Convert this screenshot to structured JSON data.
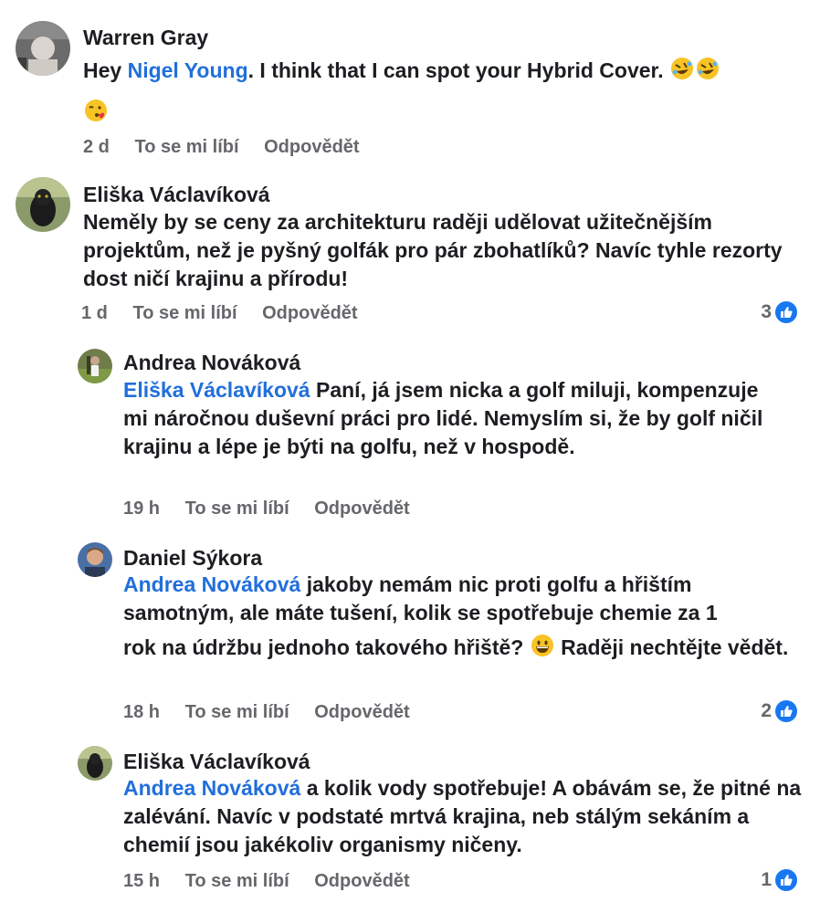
{
  "comments": [
    {
      "author": "Warren Gray",
      "mention": "Nigel Young",
      "text_before": "Hey ",
      "text_after": ". I think that I can spot your Hybrid Cover.",
      "emojis": [
        "rolling-on-floor-laughing",
        "rolling-on-floor-laughing",
        "face-blowing-kiss"
      ],
      "time": "2 d",
      "like_label": "To se mi líbí",
      "reply_label": "Odpovědět"
    },
    {
      "author": "Eliška Václavíková",
      "text": "Neměly by se ceny za architekturu raději udělovat užitečnějším projektům, než je pyšný golfák pro pár zbohatlíků? Navíc tyhle rezorty dost ničí krajinu a přírodu!",
      "time": "1 d",
      "like_label": "To se mi líbí",
      "reply_label": "Odpovědět",
      "likes": "3"
    },
    {
      "author": "Andrea Nováková",
      "mention": "Eliška Václavíková",
      "text": "Paní, já jsem nicka a golf miluji, kompenzuje mi náročnou duševní práci pro lidé. Nemyslím si, že by golf ničil krajinu a lépe je býti na golfu, než v hospodě.",
      "time": "19 h",
      "like_label": "To se mi líbí",
      "reply_label": "Odpovědět"
    },
    {
      "author": "Daniel Sýkora",
      "mention": "Andrea Nováková",
      "text_line1": "jakoby nemám nic proti golfu a hřištím samotným, ale máte tušení, kolik se spotřebuje chemie za 1",
      "text_line2_a": "rok na údržbu jednoho takového hřiště?",
      "text_line2_b": "Raději nechtějte vědět.",
      "emoji": "grinning-face",
      "time": "18 h",
      "like_label": "To se mi líbí",
      "reply_label": "Odpovědět",
      "likes": "2"
    },
    {
      "author": "Eliška Václavíková",
      "mention": "Andrea Nováková",
      "text": "a kolik vody spotřebuje! A obávám se, že pitné na zalévání. Navíc v podstaté mrtvá krajina, neb stálým sekáním a chemií jsou jakékoliv organismy ničeny.",
      "time": "15 h",
      "like_label": "To se mi líbí",
      "reply_label": "Odpovědět",
      "likes": "1"
    }
  ],
  "colors": {
    "mention": "#216fdb",
    "meta": "#65676b",
    "like_badge": "#1877f2"
  }
}
